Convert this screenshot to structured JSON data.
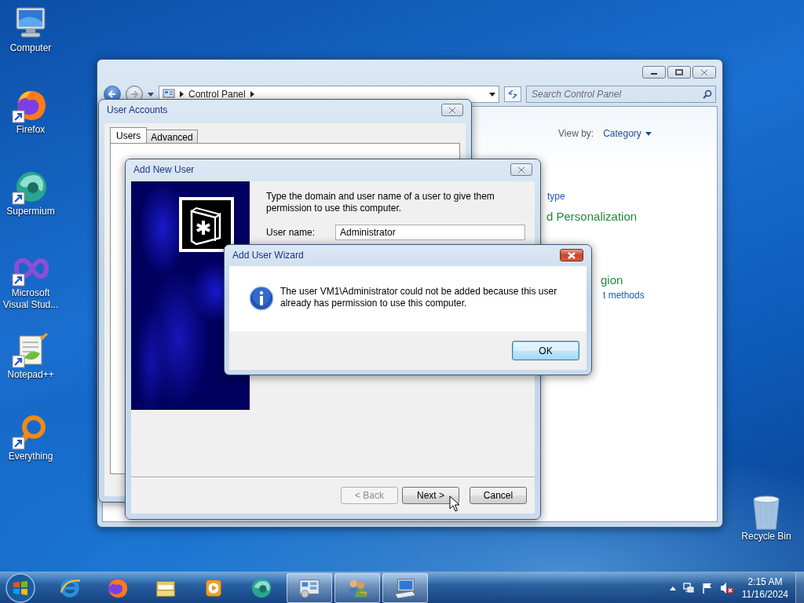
{
  "desktop_icons": [
    {
      "label": "Computer",
      "kind": "computer",
      "shortcut": false
    },
    {
      "label": "Firefox",
      "kind": "firefox",
      "shortcut": true
    },
    {
      "label": "Supermium",
      "kind": "supermium",
      "shortcut": true
    },
    {
      "label": "Microsoft Visual Stud...",
      "kind": "visualstudio",
      "shortcut": true
    },
    {
      "label": "Notepad++",
      "kind": "notepad",
      "shortcut": true
    },
    {
      "label": "Everything",
      "kind": "everything",
      "shortcut": true
    }
  ],
  "recycle_bin": {
    "label": "Recycle Bin"
  },
  "control_panel": {
    "address": "Control Panel",
    "search": {
      "placeholder": "Search Control Panel"
    },
    "view_by": {
      "label": "View by:",
      "value": "Category"
    },
    "partial_texts": [
      {
        "text": "type",
        "kind": "link"
      },
      {
        "text": "d Personalization",
        "kind": "heading"
      },
      {
        "text": "gion",
        "kind": "heading"
      },
      {
        "text": "t methods",
        "kind": "link"
      }
    ]
  },
  "user_accounts": {
    "title": "User Accounts",
    "tabs": [
      {
        "label": "Users",
        "selected": true
      },
      {
        "label": "Advanced",
        "selected": false
      }
    ]
  },
  "add_new_user": {
    "title": "Add New User",
    "instruction": "Type the domain and user name of a user to give them permission to use this computer.",
    "user_name": {
      "label": "User name:",
      "value": "Administrator"
    },
    "buttons": [
      {
        "label": "< Back",
        "disabled": true
      },
      {
        "label": "Next >",
        "disabled": false
      },
      {
        "label": "Cancel",
        "disabled": false
      }
    ]
  },
  "message_box": {
    "title": "Add User Wizard",
    "message": "The user VM1\\Administrator could not be added because this user already has permission to use this computer.",
    "button": "OK"
  },
  "taskbar": {
    "items": [
      {
        "kind": "ie",
        "active": false
      },
      {
        "kind": "firefox",
        "active": false
      },
      {
        "kind": "explorer",
        "active": false
      },
      {
        "kind": "media",
        "active": false
      },
      {
        "kind": "supermium",
        "active": false
      },
      {
        "kind": "control_panel",
        "active": true
      },
      {
        "kind": "users",
        "active": true
      },
      {
        "kind": "computer",
        "active": true
      }
    ]
  },
  "clock": {
    "time": "2:15 AM",
    "date": "11/16/2024"
  }
}
